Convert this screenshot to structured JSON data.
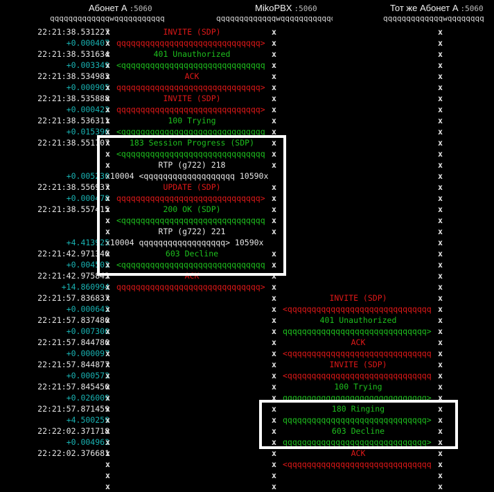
{
  "header": {
    "endpoints": [
      {
        "name": "Абонет А",
        "port": ":5060"
      },
      {
        "name": "MikoPBX",
        "port": ":5060"
      },
      {
        "name": "Тот же Абонет А",
        "port": ":5060"
      }
    ],
    "rules": [
      "qqqqqqqqqqqqqwqqqqqqqqqqq",
      "qqqqqqqqqqqqqwqqqqqqqqqqqq",
      "qqqqqqqqqqqqqwqqqqqqqq"
    ]
  },
  "rows": [
    {
      "time": "22:21:38.531227",
      "kind": "abs",
      "label": "INVITE (SDP)",
      "color": "red"
    },
    {
      "time": "+0.000407",
      "kind": "rel",
      "arrow": "qqqqqqqqqqqqqqqqqqqqqqqqqqqqqq>",
      "color": "red",
      "dir": "ab"
    },
    {
      "time": "22:21:38.531634",
      "kind": "abs",
      "label": "401 Unauthorized",
      "color": "green"
    },
    {
      "time": "+0.003349",
      "kind": "rel",
      "arrow": "<qqqqqqqqqqqqqqqqqqqqqqqqqqqqqq",
      "color": "green",
      "dir": "ab"
    },
    {
      "time": "22:21:38.534983",
      "kind": "abs",
      "label": "ACK",
      "color": "red"
    },
    {
      "time": "+0.000905",
      "kind": "rel",
      "arrow": "qqqqqqqqqqqqqqqqqqqqqqqqqqqqqq>",
      "color": "red",
      "dir": "ab"
    },
    {
      "time": "22:21:38.535888",
      "kind": "abs",
      "label": "INVITE (SDP)",
      "color": "red"
    },
    {
      "time": "+0.000423",
      "kind": "rel",
      "arrow": "qqqqqqqqqqqqqqqqqqqqqqqqqqqqqq>",
      "color": "red",
      "dir": "ab"
    },
    {
      "time": "22:21:38.536311",
      "kind": "abs",
      "label": "100 Trying",
      "color": "green"
    },
    {
      "time": "+0.015396",
      "kind": "rel",
      "arrow": "<qqqqqqqqqqqqqqqqqqqqqqqqqqqqqq",
      "color": "green",
      "dir": "ab"
    },
    {
      "time": "22:21:38.551707",
      "kind": "abs",
      "label": "183 Session Progress (SDP)",
      "color": "green"
    },
    {
      "time": "",
      "kind": "rel",
      "arrow": "<qqqqqqqqqqqqqqqqqqqqqqqqqqqqqq",
      "color": "green",
      "dir": "ab"
    },
    {
      "time": "",
      "kind": "rel",
      "label": "RTP (g722) 218",
      "color": "white"
    },
    {
      "time": "+0.005230",
      "kind": "rel",
      "rtp": "x10004 <qqqqqqqqqqqqqqqqqqq 10590x"
    },
    {
      "time": "22:21:38.556937",
      "kind": "abs",
      "label": "UPDATE (SDP)",
      "color": "red"
    },
    {
      "time": "+0.000478",
      "kind": "rel",
      "arrow": "qqqqqqqqqqqqqqqqqqqqqqqqqqqqqq>",
      "color": "red",
      "dir": "ab"
    },
    {
      "time": "22:21:38.557415",
      "kind": "abs",
      "label": "200 OK (SDP)",
      "color": "green"
    },
    {
      "time": "",
      "kind": "rel",
      "arrow": "<qqqqqqqqqqqqqqqqqqqqqqqqqqqqqq",
      "color": "green",
      "dir": "ab"
    },
    {
      "time": "",
      "kind": "rel",
      "label": "RTP (g722) 221",
      "color": "white"
    },
    {
      "time": "+4.413925",
      "kind": "rel",
      "rtp": "x10004 qqqqqqqqqqqqqqqqqq> 10590x"
    },
    {
      "time": "22:21:42.971340",
      "kind": "abs",
      "label": "603 Decline",
      "color": "green"
    },
    {
      "time": "+0.004503",
      "kind": "rel",
      "arrow": "<qqqqqqqqqqqqqqqqqqqqqqqqqqqqqq",
      "color": "green",
      "dir": "ab"
    },
    {
      "time": "22:21:42.975843",
      "kind": "abs",
      "label": "ACK",
      "color": "red"
    },
    {
      "time": "+14.860994",
      "kind": "rel",
      "arrow": "qqqqqqqqqqqqqqqqqqqqqqqqqqqqqq>",
      "color": "red",
      "dir": "ab"
    },
    {
      "time": "22:21:57.836837",
      "kind": "abs",
      "label": "INVITE (SDP)",
      "color": "red",
      "col": "bc"
    },
    {
      "time": "+0.000643",
      "kind": "rel",
      "arrow": "<qqqqqqqqqqqqqqqqqqqqqqqqqqqqqq",
      "color": "red",
      "dir": "bc"
    },
    {
      "time": "22:21:57.837480",
      "kind": "abs",
      "label": "401 Unauthorized",
      "color": "green",
      "col": "bc"
    },
    {
      "time": "+0.007300",
      "kind": "rel",
      "arrow": "qqqqqqqqqqqqqqqqqqqqqqqqqqqqqq>",
      "color": "green",
      "dir": "bc"
    },
    {
      "time": "22:21:57.844780",
      "kind": "abs",
      "label": "ACK",
      "color": "red",
      "col": "bc"
    },
    {
      "time": "+0.000097",
      "kind": "rel",
      "arrow": "<qqqqqqqqqqqqqqqqqqqqqqqqqqqqqq",
      "color": "red",
      "dir": "bc"
    },
    {
      "time": "22:21:57.844877",
      "kind": "abs",
      "label": "INVITE (SDP)",
      "color": "red",
      "col": "bc"
    },
    {
      "time": "+0.000573",
      "kind": "rel",
      "arrow": "<qqqqqqqqqqqqqqqqqqqqqqqqqqqqqq",
      "color": "red",
      "dir": "bc"
    },
    {
      "time": "22:21:57.845450",
      "kind": "abs",
      "label": "100 Trying",
      "color": "green",
      "col": "bc"
    },
    {
      "time": "+0.026009",
      "kind": "rel",
      "arrow": "qqqqqqqqqqqqqqqqqqqqqqqqqqqqqq>",
      "color": "green",
      "dir": "bc"
    },
    {
      "time": "22:21:57.871459",
      "kind": "abs",
      "label": "180 Ringing",
      "color": "green",
      "col": "bc"
    },
    {
      "time": "+4.500259",
      "kind": "rel",
      "arrow": "qqqqqqqqqqqqqqqqqqqqqqqqqqqqqq>",
      "color": "green",
      "dir": "bc"
    },
    {
      "time": "22:22:02.371718",
      "kind": "abs",
      "label": "603 Decline",
      "color": "green",
      "col": "bc"
    },
    {
      "time": "+0.004963",
      "kind": "rel",
      "arrow": "qqqqqqqqqqqqqqqqqqqqqqqqqqqqqq>",
      "color": "green",
      "dir": "bc"
    },
    {
      "time": "22:22:02.376681",
      "kind": "abs",
      "label": "ACK",
      "color": "red",
      "col": "bc"
    },
    {
      "time": "",
      "kind": "rel",
      "arrow": "<qqqqqqqqqqqqqqqqqqqqqqqqqqqqqq",
      "color": "red",
      "dir": "bc"
    },
    {
      "time": "",
      "kind": "rel"
    },
    {
      "time": "",
      "kind": "rel"
    }
  ],
  "colors": {
    "background": "#000000",
    "request": "#e01818",
    "response": "#1ec01e",
    "relative_time": "#19b3b3",
    "highlight_box": "#ffffff"
  }
}
